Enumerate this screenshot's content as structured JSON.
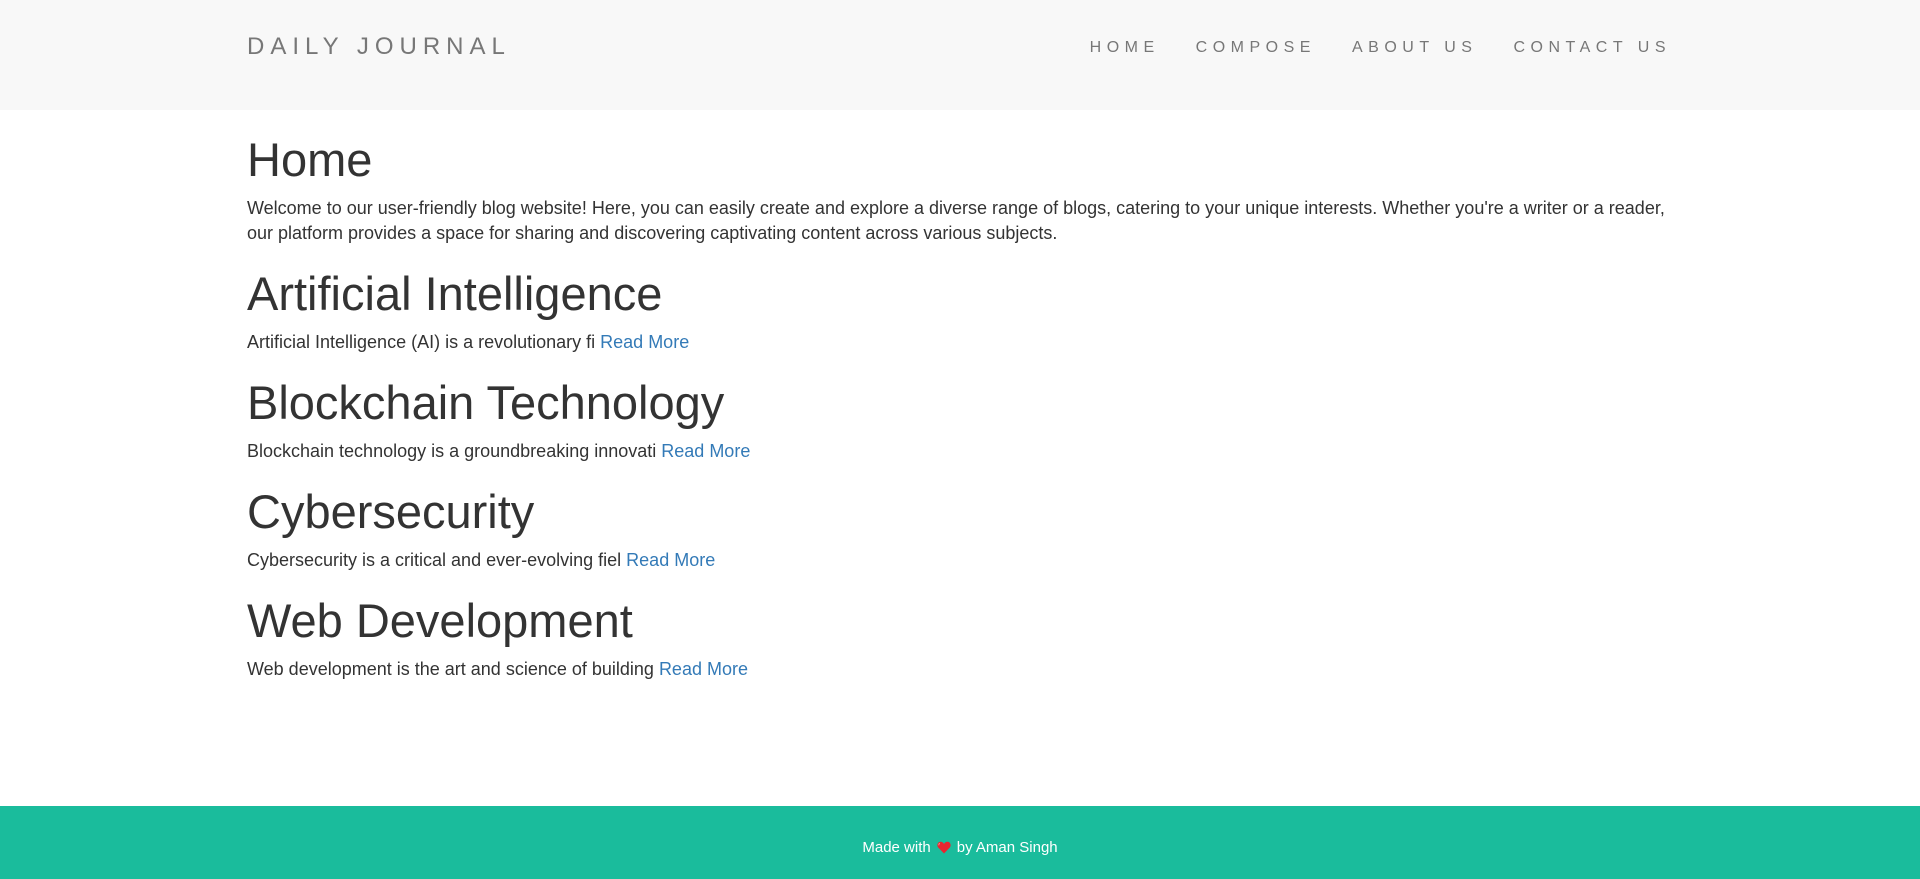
{
  "navbar": {
    "brand": "DAILY JOURNAL",
    "items": [
      {
        "label": "HOME"
      },
      {
        "label": "COMPOSE"
      },
      {
        "label": "ABOUT US"
      },
      {
        "label": "CONTACT US"
      }
    ]
  },
  "main": {
    "title": "Home",
    "intro": "Welcome to our user-friendly blog website! Here, you can easily create and explore a diverse range of blogs, catering to your unique interests. Whether you're a writer or a reader, our platform provides a space for sharing and discovering captivating content across various subjects.",
    "posts": [
      {
        "title": "Artificial Intelligence",
        "excerpt": "Artificial Intelligence (AI) is a revolutionary fi",
        "link": "Read More"
      },
      {
        "title": "Blockchain Technology",
        "excerpt": "Blockchain technology is a groundbreaking innovati",
        "link": "Read More"
      },
      {
        "title": "Cybersecurity",
        "excerpt": "Cybersecurity is a critical and ever-evolving fiel",
        "link": "Read More"
      },
      {
        "title": "Web Development",
        "excerpt": "Web development is the art and science of building",
        "link": "Read More"
      }
    ]
  },
  "footer": {
    "prefix": "Made with",
    "icon": "heart-icon",
    "suffix": "by Aman Singh",
    "background": "#1abc9c",
    "heart_color": "#e8252f"
  },
  "colors": {
    "link": "#337ab7",
    "nav_text": "#777777",
    "navbar_bg": "#f8f8f8"
  }
}
